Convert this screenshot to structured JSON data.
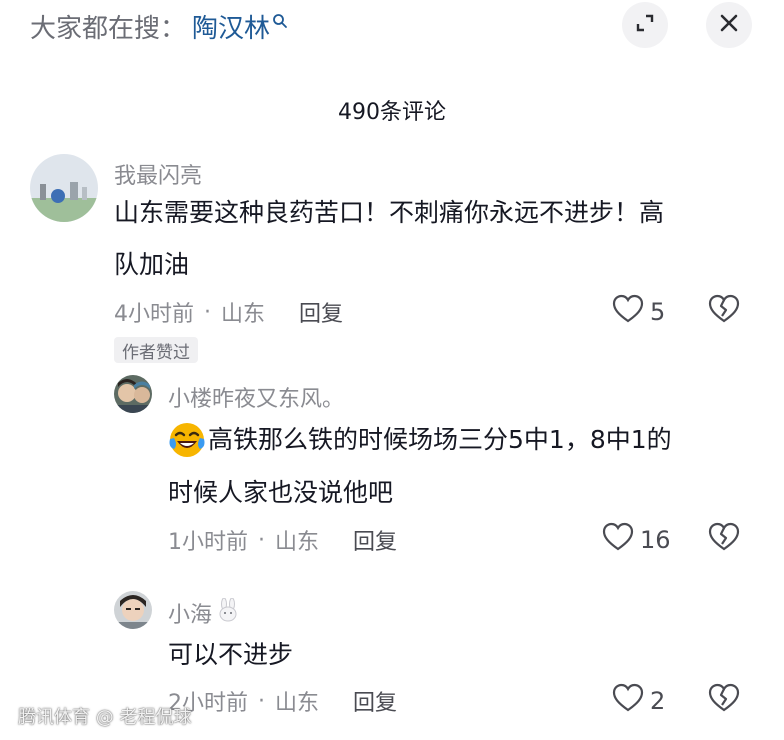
{
  "search": {
    "prefix": "大家都在搜：",
    "term": "陶汉林"
  },
  "header": {
    "comment_count": "490条评论"
  },
  "comments": [
    {
      "username": "我最闪亮",
      "text_line1": "山东需要这种良药苦口！不刺痛你永远不进步！高",
      "text_line2": "队加油",
      "time": "4小时前",
      "dot": "·",
      "location": "山东",
      "reply_label": "回复",
      "likes": "5",
      "badge": "作者赞过"
    },
    {
      "username": "小楼昨夜又东风。",
      "text_line1": "高铁那么铁的时候场场三分5中1，8中1的",
      "text_line2": "时候人家也没说他吧",
      "time": "1小时前",
      "dot": "·",
      "location": "山东",
      "reply_label": "回复",
      "likes": "16"
    },
    {
      "username": "小海",
      "text_line1": "可以不进步",
      "time": "2小时前",
      "dot": "·",
      "location": "山东",
      "reply_label": "回复",
      "likes": "2"
    }
  ],
  "watermark": "腾讯体育 @ 老程侃球",
  "colors": {
    "link": "#1f5a96",
    "meta": "#8a8b91",
    "text": "#161823",
    "emoji": "#f7b500"
  }
}
